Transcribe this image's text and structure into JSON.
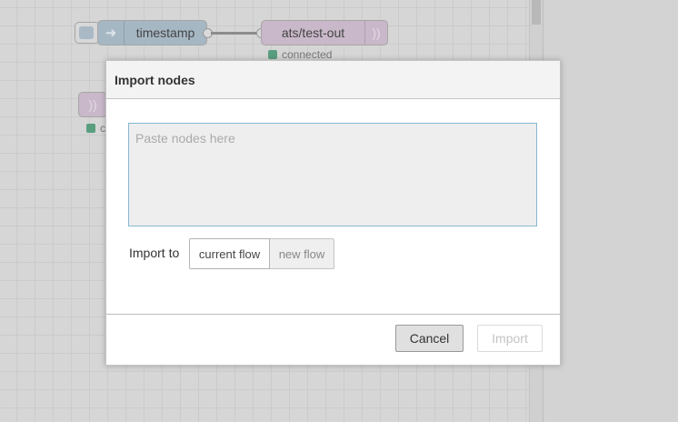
{
  "workspace": {
    "inject_node": {
      "label": "timestamp",
      "icon": "arrow-right-icon"
    },
    "mqtt_out_node": {
      "label": "ats/test-out",
      "icon": "wifi-icon",
      "status": "connected"
    },
    "mqtt_node_2": {
      "icon": "wifi-icon",
      "status": "c"
    }
  },
  "dialog": {
    "title": "Import nodes",
    "paste_placeholder": "Paste nodes here",
    "paste_value": "",
    "import_to_label": "Import to",
    "options": {
      "current": "current flow",
      "new": "new flow"
    },
    "selected_option": "current flow",
    "cancel_label": "Cancel",
    "import_label": "Import"
  },
  "colors": {
    "accent_border": "#85b8d1",
    "status_green": "#5a9e80",
    "inject_node": "#a6b7c4",
    "mqtt_node": "#c9b8c9"
  }
}
